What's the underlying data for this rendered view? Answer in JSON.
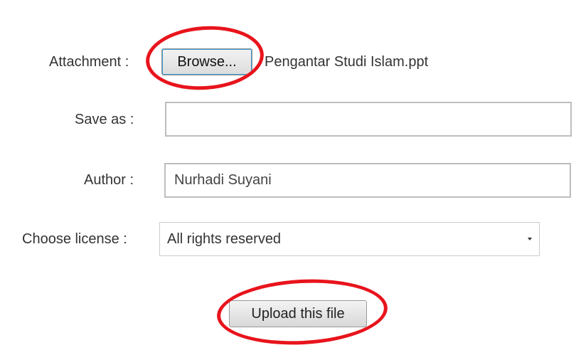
{
  "form": {
    "attachment": {
      "label": "Attachment :",
      "browse_label": "Browse...",
      "file_name": "Pengantar Studi Islam.ppt"
    },
    "save_as": {
      "label": "Save as :",
      "value": ""
    },
    "author": {
      "label": "Author :",
      "value": "Nurhadi Suyani"
    },
    "license": {
      "label": "Choose license :",
      "selected": "All rights reserved"
    },
    "upload_label": "Upload this file"
  },
  "colors": {
    "highlight": "#e8141c",
    "input_border": "#bdbdbd",
    "text": "#333333"
  },
  "icons": {
    "select_caret": "chevron-down-icon"
  }
}
